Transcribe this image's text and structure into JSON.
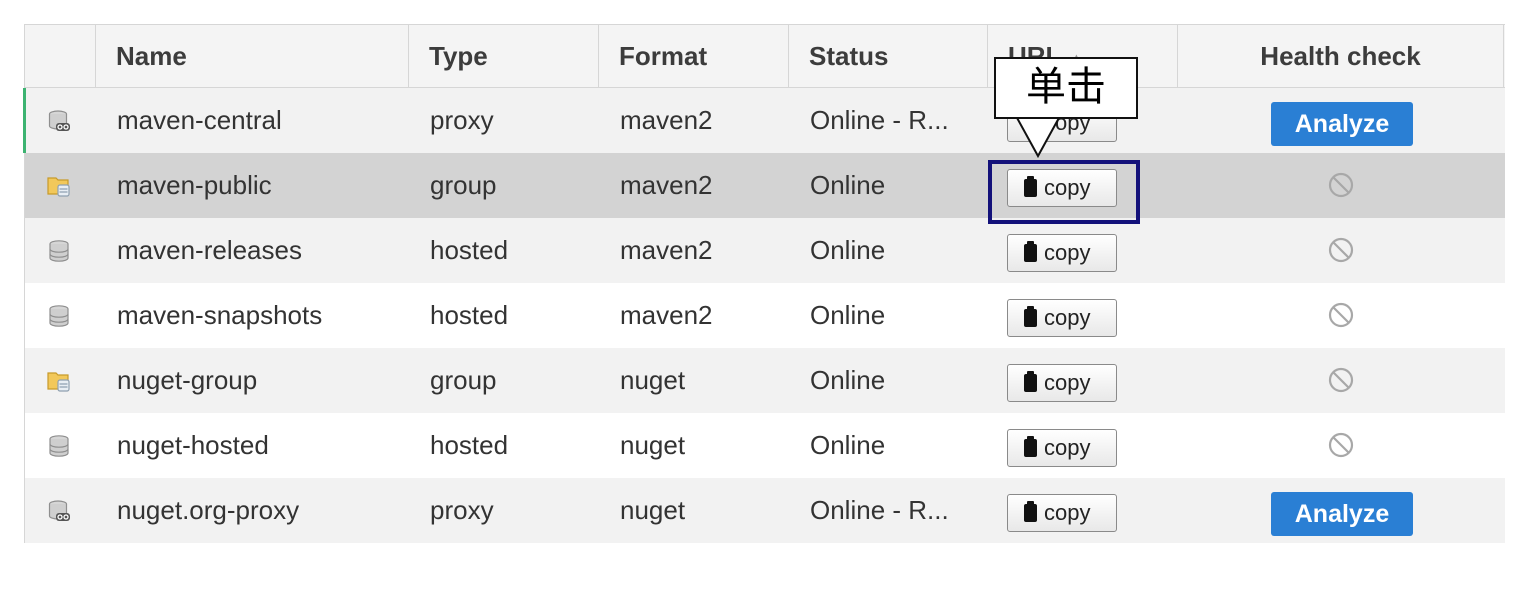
{
  "columns": {
    "name": "Name",
    "type": "Type",
    "format": "Format",
    "status": "Status",
    "url": "URL",
    "url_sort_indicator": "▲",
    "health": "Health check"
  },
  "icons": {
    "proxy": "proxy-repository-icon",
    "group": "group-repository-icon",
    "hosted": "hosted-repository-icon",
    "health_disabled": "not-available-icon",
    "clipboard": "clipboard-icon"
  },
  "colors": {
    "analyze": "#2a7fd4",
    "selected_row": "#d3d3d3",
    "highlight": "#13117a",
    "row_indicator": "#3cb371"
  },
  "rows": [
    {
      "name": "maven-central",
      "type": "proxy",
      "format": "maven2",
      "status": "Online - R...",
      "copy": "copy",
      "health": "Analyze"
    },
    {
      "name": "maven-public",
      "type": "group",
      "format": "maven2",
      "status": "Online",
      "copy": "copy",
      "health": ""
    },
    {
      "name": "maven-releases",
      "type": "hosted",
      "format": "maven2",
      "status": "Online",
      "copy": "copy",
      "health": ""
    },
    {
      "name": "maven-snapshots",
      "type": "hosted",
      "format": "maven2",
      "status": "Online",
      "copy": "copy",
      "health": ""
    },
    {
      "name": "nuget-group",
      "type": "group",
      "format": "nuget",
      "status": "Online",
      "copy": "copy",
      "health": ""
    },
    {
      "name": "nuget-hosted",
      "type": "hosted",
      "format": "nuget",
      "status": "Online",
      "copy": "copy",
      "health": ""
    },
    {
      "name": "nuget.org-proxy",
      "type": "proxy",
      "format": "nuget",
      "status": "Online - R...",
      "copy": "copy",
      "health": "Analyze"
    }
  ],
  "annotation": {
    "callout_text": "单击"
  }
}
